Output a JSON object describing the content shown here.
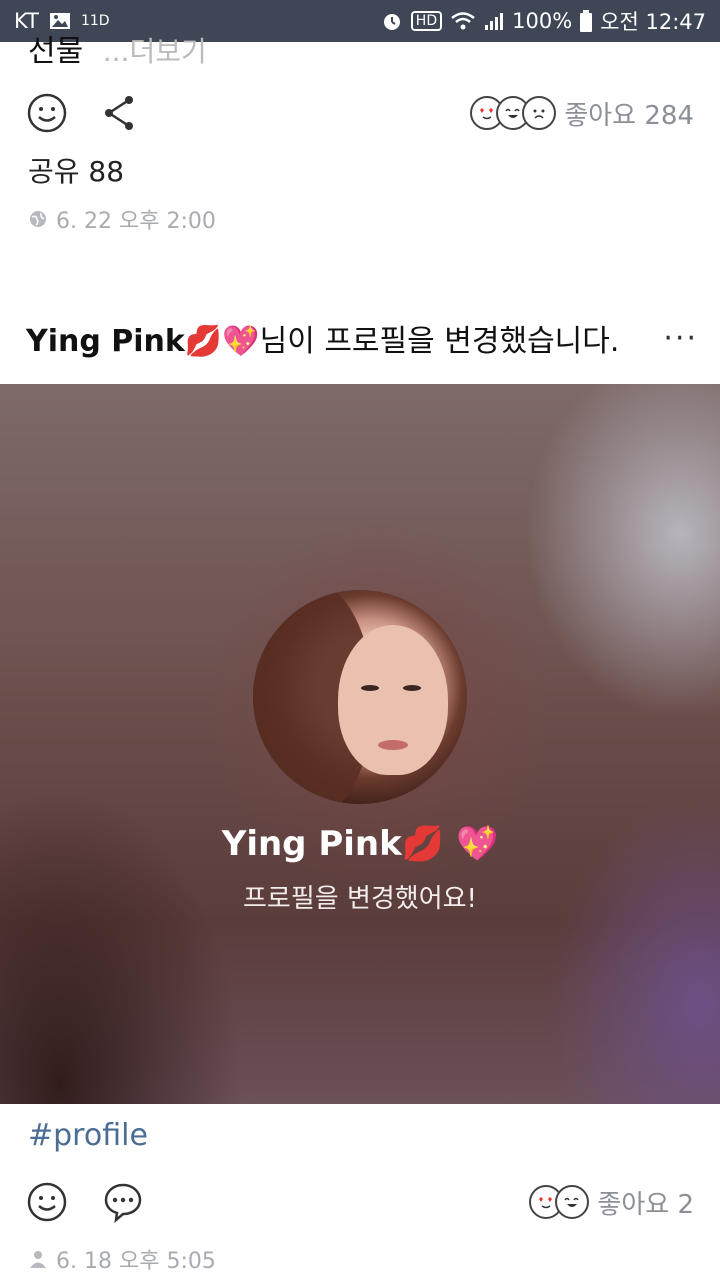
{
  "status_bar": {
    "carrier": "KT",
    "left_label": "11D",
    "hd": "HD",
    "battery": "100%",
    "time": "오전 12:47"
  },
  "post_top": {
    "cut_text": "선물",
    "more_text": "...더보기",
    "likes_label": "좋아요 284",
    "share_count": "공유 88",
    "date": "6. 22 오후 2:00"
  },
  "post_profile": {
    "header_name": "Ying Pink",
    "header_text": "님이 프로필을 변경했습니다.",
    "more": "···",
    "card_name": "Ying Pink",
    "card_caption": "프로필을 변경했어요!",
    "hashtag": "#profile",
    "likes_label": "좋아요 2",
    "date": "6. 18 오후 5:05"
  },
  "emoji": {
    "kiss": "💋",
    "heart": "💖"
  }
}
